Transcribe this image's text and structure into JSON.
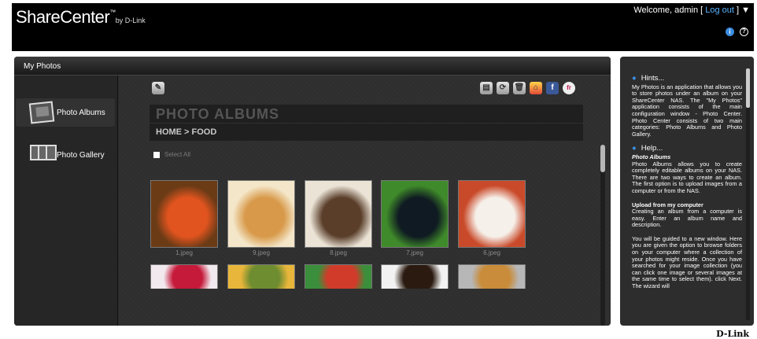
{
  "header": {
    "brand": "ShareCenter",
    "brand_tm": "™",
    "brand_by": "by D-Link",
    "welcome_prefix": "Welcome, admin [",
    "logout": "Log out",
    "welcome_suffix": "] ▼",
    "info_icon": "i",
    "help_icon": "?"
  },
  "panel": {
    "title": "My Photos"
  },
  "sidebar": {
    "items": [
      {
        "label": "Photo Albums",
        "icon": "photo-albums-icon",
        "active": true
      },
      {
        "label": "Photo Gallery",
        "icon": "photo-gallery-icon",
        "active": false
      }
    ]
  },
  "toolbar": {
    "edit_icon": "✎",
    "buttons": [
      "▤",
      "⟳",
      "🗑",
      "⌂",
      "f",
      "fr"
    ]
  },
  "album": {
    "heading": "PHOTO ALBUMS",
    "breadcrumb": "HOME > FOOD",
    "select_all": "Select All"
  },
  "photos": [
    {
      "caption": "1.jpeg",
      "subject": "burger",
      "colors": [
        "#e2541f",
        "#6b3b16"
      ]
    },
    {
      "caption": "9.jpeg",
      "subject": "pancakes",
      "colors": [
        "#d89a4a",
        "#f4e6c8"
      ]
    },
    {
      "caption": "8.jpeg",
      "subject": "fish-plate",
      "colors": [
        "#5a3e2a",
        "#eae3d6"
      ]
    },
    {
      "caption": "7.jpeg",
      "subject": "salad",
      "colors": [
        "#0f1a22",
        "#3f8a2a"
      ]
    },
    {
      "caption": "6.jpeg",
      "subject": "vegetables",
      "colors": [
        "#f6f0ea",
        "#c94a2a"
      ]
    },
    {
      "caption": "",
      "subject": "berries",
      "colors": [
        "#c51a3a",
        "#f2e9ee"
      ]
    },
    {
      "caption": "",
      "subject": "fruits",
      "colors": [
        "#6e8c30",
        "#e8b63a"
      ]
    },
    {
      "caption": "",
      "subject": "fruit-salad",
      "colors": [
        "#d13b2a",
        "#3b8e3b"
      ]
    },
    {
      "caption": "",
      "subject": "cake",
      "colors": [
        "#2a1a10",
        "#f2f2f2"
      ]
    },
    {
      "caption": "",
      "subject": "sandwich",
      "colors": [
        "#c98c3a",
        "#b7b7b7"
      ]
    }
  ],
  "hints": {
    "hints_title": "Hints...",
    "hints_text": "My Photos is an application that allows you to store photos under an album on your ShareCenter NAS. The \"My Photos\" application consists of the main configuration window - Photo Center. Photo Center consists of two main categories: Photo Albums and Photo Gallery.",
    "help_title": "Help...",
    "help_sub": "Photo Albums",
    "help_text": "Photo Albums allows you to create completely editable albums on your NAS. There are two ways to create an album. The first option is to upload images from a computer or from the NAS.",
    "upload_title": "Upload from my computer",
    "upload_text": "Creating an album from a computer is easy. Enter an album name and description.",
    "guide_text": "You will be guided to a new window. Here you are given the option to browse folders on your computer where a collection of your photos might reside. Once you have searched for your image collection (you can click one image or several images at the same time to select them). click Next. The wizard will"
  },
  "footer": {
    "logo": "D-Link"
  }
}
